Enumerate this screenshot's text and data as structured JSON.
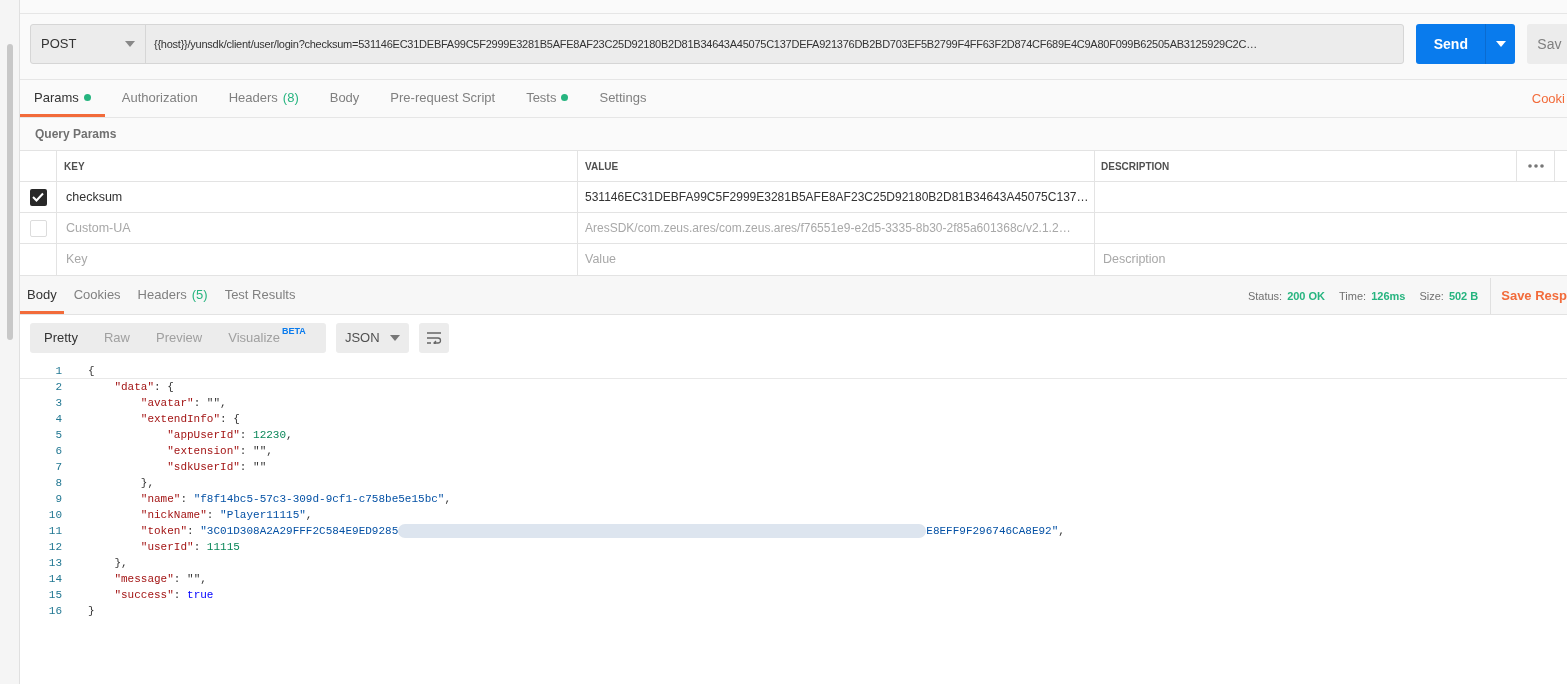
{
  "request": {
    "method": "POST",
    "url": "{{host}}/yunsdk/client/user/login?checksum=531146EC31DEBFA99C5F2999E3281B5AFE8AF23C25D92180B2D81B34643A45075C137DEFA921376DB2BD703EF5B2799F4FF63F2D874CF689E4C9A80F099B62505AB3125929C2C…",
    "send_label": "Send",
    "save_label": "Sav"
  },
  "request_tabs": [
    {
      "label": "Params",
      "dot": true,
      "selected": true
    },
    {
      "label": "Authorization",
      "dot": false,
      "selected": false
    },
    {
      "label": "Headers",
      "count": "(8)",
      "dot": false,
      "selected": false
    },
    {
      "label": "Body",
      "dot": false,
      "selected": false
    },
    {
      "label": "Pre-request Script",
      "dot": false,
      "selected": false
    },
    {
      "label": "Tests",
      "dot": true,
      "selected": false
    },
    {
      "label": "Settings",
      "dot": false,
      "selected": false
    }
  ],
  "cookies_link": "Cooki",
  "query_params": {
    "title": "Query Params",
    "columns": [
      "KEY",
      "VALUE",
      "DESCRIPTION"
    ],
    "rows": [
      {
        "checked": true,
        "key": "checksum",
        "value": "531146EC31DEBFA99C5F2999E3281B5AFE8AF23C25D92180B2D81B34643A45075C137…"
      },
      {
        "checked": false,
        "key": "Custom-UA",
        "value": "AresSDK/com.zeus.ares/com.zeus.ares/f76551e9-e2d5-3335-8b30-2f85a601368c/v2.1.2…"
      }
    ],
    "new_row": {
      "key": {
        "placeholder": "Key"
      },
      "value": {
        "placeholder": "Value"
      },
      "description": {
        "placeholder": "Description"
      }
    }
  },
  "response_tabs": [
    {
      "label": "Body",
      "selected": true
    },
    {
      "label": "Cookies",
      "selected": false
    },
    {
      "label": "Headers",
      "count": "(5)",
      "selected": false
    },
    {
      "label": "Test Results",
      "selected": false
    }
  ],
  "status": [
    {
      "label": "Status:",
      "value": "200 OK"
    },
    {
      "label": "Time:",
      "value": "126ms"
    },
    {
      "label": "Size:",
      "value": "502 B"
    }
  ],
  "save_response": "Save Resp",
  "view_modes": [
    {
      "label": "Pretty",
      "selected": true
    },
    {
      "label": "Raw",
      "selected": false
    },
    {
      "label": "Preview",
      "selected": false
    },
    {
      "label": "Visualize",
      "badge": "BETA",
      "selected": false
    }
  ],
  "format": "JSON",
  "code_lines": [
    {
      "number": "1",
      "tokens": [
        {
          "kind": "punct",
          "text": "{"
        }
      ]
    },
    {
      "number": "2",
      "tokens": [
        {
          "kind": "key",
          "text": "    \"data\""
        },
        {
          "kind": "punct",
          "text": ": {"
        }
      ]
    },
    {
      "number": "3",
      "tokens": [
        {
          "kind": "key",
          "text": "        \"avatar\""
        },
        {
          "kind": "punct",
          "text": ": \"\","
        }
      ]
    },
    {
      "number": "4",
      "tokens": [
        {
          "kind": "key",
          "text": "        \"extendInfo\""
        },
        {
          "kind": "punct",
          "text": ": {"
        }
      ]
    },
    {
      "number": "5",
      "tokens": [
        {
          "kind": "key",
          "text": "            \"appUserId\""
        },
        {
          "kind": "punct",
          "text": ": "
        },
        {
          "kind": "num",
          "text": "12230"
        },
        {
          "kind": "punct",
          "text": ","
        }
      ]
    },
    {
      "number": "6",
      "tokens": [
        {
          "kind": "key",
          "text": "            \"extension\""
        },
        {
          "kind": "punct",
          "text": ": \"\","
        }
      ]
    },
    {
      "number": "7",
      "tokens": [
        {
          "kind": "key",
          "text": "            \"sdkUserId\""
        },
        {
          "kind": "punct",
          "text": ": \"\""
        }
      ]
    },
    {
      "number": "8",
      "tokens": [
        {
          "kind": "punct",
          "text": "        },"
        }
      ]
    },
    {
      "number": "9",
      "tokens": [
        {
          "kind": "key",
          "text": "        \"name\""
        },
        {
          "kind": "punct",
          "text": ": "
        },
        {
          "kind": "str",
          "text": "\"f8f14bc5-57c3-309d-9cf1-c758be5e15bc\""
        },
        {
          "kind": "punct",
          "text": ","
        }
      ]
    },
    {
      "number": "10",
      "tokens": [
        {
          "kind": "key",
          "text": "        \"nickName\""
        },
        {
          "kind": "punct",
          "text": ": "
        },
        {
          "kind": "str",
          "text": "\"Player11115\""
        },
        {
          "kind": "punct",
          "text": ","
        }
      ]
    },
    {
      "number": "11",
      "tokens": [
        {
          "kind": "key",
          "text": "        \"token\""
        },
        {
          "kind": "punct",
          "text": ": "
        },
        {
          "kind": "str",
          "text": "\"3C01D308A2A29FFF2C584E9ED9285"
        },
        {
          "kind": "redacted"
        },
        {
          "kind": "str",
          "text": "E8EFF9F296746CA8E92\""
        },
        {
          "kind": "punct",
          "text": ","
        }
      ]
    },
    {
      "number": "12",
      "tokens": [
        {
          "kind": "key",
          "text": "        \"userId\""
        },
        {
          "kind": "punct",
          "text": ": "
        },
        {
          "kind": "num",
          "text": "11115"
        }
      ]
    },
    {
      "number": "13",
      "tokens": [
        {
          "kind": "punct",
          "text": "    },"
        }
      ]
    },
    {
      "number": "14",
      "tokens": [
        {
          "kind": "key",
          "text": "    \"message\""
        },
        {
          "kind": "punct",
          "text": ": \"\","
        }
      ]
    },
    {
      "number": "15",
      "tokens": [
        {
          "kind": "key",
          "text": "    \"success\""
        },
        {
          "kind": "punct",
          "text": ": "
        },
        {
          "kind": "bool",
          "text": "true"
        }
      ]
    },
    {
      "number": "16",
      "tokens": [
        {
          "kind": "punct",
          "text": "}"
        }
      ]
    }
  ]
}
